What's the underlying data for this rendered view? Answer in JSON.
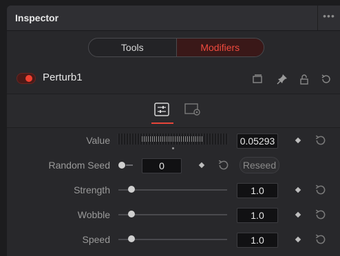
{
  "panel": {
    "title": "Inspector",
    "menu_dots": "•••"
  },
  "tabs": {
    "tools_label": "Tools",
    "modifiers_label": "Modifiers",
    "active": "Modifiers"
  },
  "node": {
    "name": "Perturb1",
    "enabled": true,
    "accent": "#f04030"
  },
  "subtabs": [
    {
      "icon": "controls-sliders-icon",
      "active": true
    },
    {
      "icon": "settings-panel-icon",
      "active": false
    }
  ],
  "params": [
    {
      "label": "Value",
      "value": "0.05293",
      "type": "ruler"
    },
    {
      "label": "Random Seed",
      "value": "0",
      "type": "seed",
      "button": "Reseed"
    },
    {
      "label": "Strength",
      "value": "1.0",
      "type": "slider",
      "position": 0.12
    },
    {
      "label": "Wobble",
      "value": "1.0",
      "type": "slider",
      "position": 0.12
    },
    {
      "label": "Speed",
      "value": "1.0",
      "type": "slider",
      "position": 0.12
    }
  ],
  "colors": {
    "accent_red": "#e8453a",
    "background": "#28282b"
  }
}
